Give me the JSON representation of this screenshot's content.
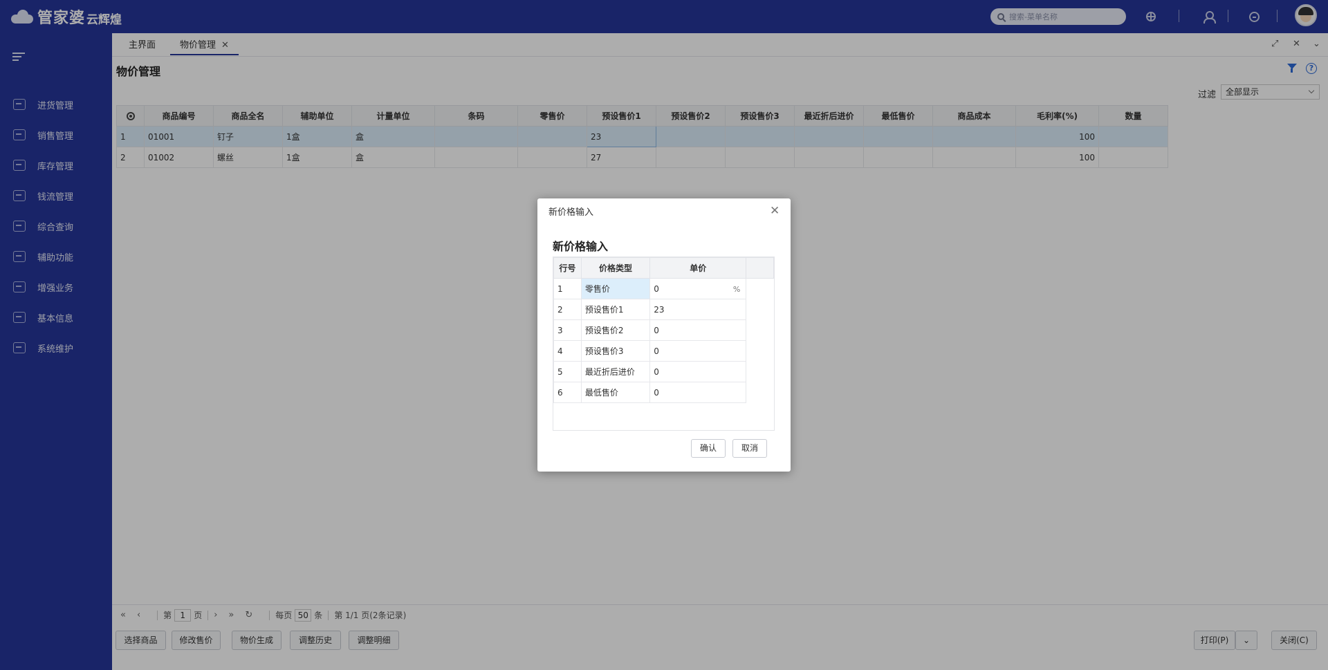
{
  "app": {
    "brand": "管家婆",
    "brand_sub": "云辉煌",
    "search_placeholder": "搜索-菜单名称"
  },
  "sidebar": {
    "items": [
      {
        "label": "进货管理",
        "icon": "cart-icon"
      },
      {
        "label": "销售管理",
        "icon": "sales-chart-icon"
      },
      {
        "label": "库存管理",
        "icon": "box-icon"
      },
      {
        "label": "钱流管理",
        "icon": "money-bag-icon"
      },
      {
        "label": "综合查询",
        "icon": "search-doc-icon"
      },
      {
        "label": "辅助功能",
        "icon": "hexagon-icon"
      },
      {
        "label": "增强业务",
        "icon": "list-icon"
      },
      {
        "label": "基本信息",
        "icon": "document-icon"
      },
      {
        "label": "系统维护",
        "icon": "handshake-icon"
      }
    ]
  },
  "tabs": [
    {
      "label": "主界面"
    },
    {
      "label": "物价管理",
      "active": true
    }
  ],
  "page": {
    "title": "物价管理",
    "filter_label": "过滤",
    "filter_value": "全部显示"
  },
  "grid": {
    "headers": [
      "商品编号",
      "商品全名",
      "辅助单位",
      "计量单位",
      "条码",
      "零售价",
      "预设售价1",
      "预设售价2",
      "预设售价3",
      "最近折后进价",
      "最低售价",
      "商品成本",
      "毛利率(%)",
      "数量"
    ],
    "rows": [
      {
        "index": "1",
        "code": "01001",
        "name": "钉子",
        "aux_unit": "1盒",
        "unit": "盒",
        "barcode": "",
        "retail": "",
        "preset1": "23",
        "preset2": "",
        "preset3": "",
        "recent_cost": "",
        "min_price": "",
        "cost": "",
        "margin": "100",
        "qty": ""
      },
      {
        "index": "2",
        "code": "01002",
        "name": "螺丝",
        "aux_unit": "1盒",
        "unit": "盒",
        "barcode": "",
        "retail": "",
        "preset1": "27",
        "preset2": "",
        "preset3": "",
        "recent_cost": "",
        "min_price": "",
        "cost": "",
        "margin": "100",
        "qty": ""
      }
    ]
  },
  "pager": {
    "page_prefix": "第",
    "page_value": "1",
    "page_suffix": "页",
    "per_page_prefix": "每页",
    "per_page_value": "50",
    "per_page_suffix": "条",
    "summary": "第 1/1 页(2条记录)"
  },
  "actions": {
    "select_goods": "选择商品",
    "modify_price": "修改售价",
    "price_generate": "物价生成",
    "adjust_history": "调整历史",
    "adjust_detail": "调整明细",
    "print": "打印(P)",
    "close": "关闭(C)"
  },
  "dialog": {
    "header": "新价格输入",
    "title": "新价格输入",
    "columns": [
      "行号",
      "价格类型",
      "单价"
    ],
    "rows": [
      {
        "index": "1",
        "type": "零售价",
        "price": "0"
      },
      {
        "index": "2",
        "type": "预设售价1",
        "price": "23"
      },
      {
        "index": "3",
        "type": "预设售价2",
        "price": "0"
      },
      {
        "index": "4",
        "type": "预设售价3",
        "price": "0"
      },
      {
        "index": "5",
        "type": "最近折后进价",
        "price": "0"
      },
      {
        "index": "6",
        "type": "最低售价",
        "price": "0"
      }
    ],
    "confirm_label": "确认",
    "cancel_label": "取消",
    "percent_icon": "%"
  },
  "colors": {
    "brand": "#25359a",
    "selection": "#dceefb",
    "accent": "#2d6bd8"
  }
}
